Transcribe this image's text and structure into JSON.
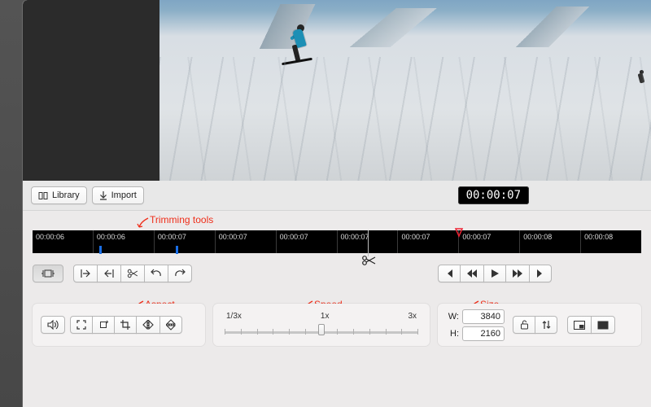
{
  "toolbar_under_preview": {
    "library_label": "Library",
    "import_label": "Import"
  },
  "timecode": "00:00:07",
  "callouts": {
    "trimming": "Trimming tools",
    "aspect": "Aspect",
    "speed": "Speed",
    "size": "Size"
  },
  "ruler_ticks": [
    "00:00:06",
    "00:00:06",
    "00:00:07",
    "00:00:07",
    "00:00:07",
    "00:00:07",
    "00:00:07",
    "00:00:07",
    "00:00:08",
    "00:00:08"
  ],
  "speed": {
    "min_label": "1/3x",
    "mid_label": "1x",
    "max_label": "3x",
    "thumb_position_pct": 50
  },
  "size": {
    "w_label": "W:",
    "h_label": "H:",
    "width": "3840",
    "height": "2160"
  },
  "icons": {
    "trim_select": "trim-select",
    "trim_in": "trim-in",
    "trim_out": "trim-out",
    "cut": "scissors",
    "undo": "undo",
    "redo": "redo",
    "skip_start": "skip-start",
    "step_back": "step-back",
    "play": "play",
    "step_fwd": "step-fwd",
    "skip_end": "skip-end",
    "audio": "audio",
    "fullscreen": "fullscreen",
    "rotate": "rotate",
    "crop": "crop",
    "flip_h": "flip-h",
    "flip_v": "flip-v",
    "lock": "lock",
    "swap": "swap",
    "pip_small": "pip-small",
    "pip_full": "pip-full"
  }
}
